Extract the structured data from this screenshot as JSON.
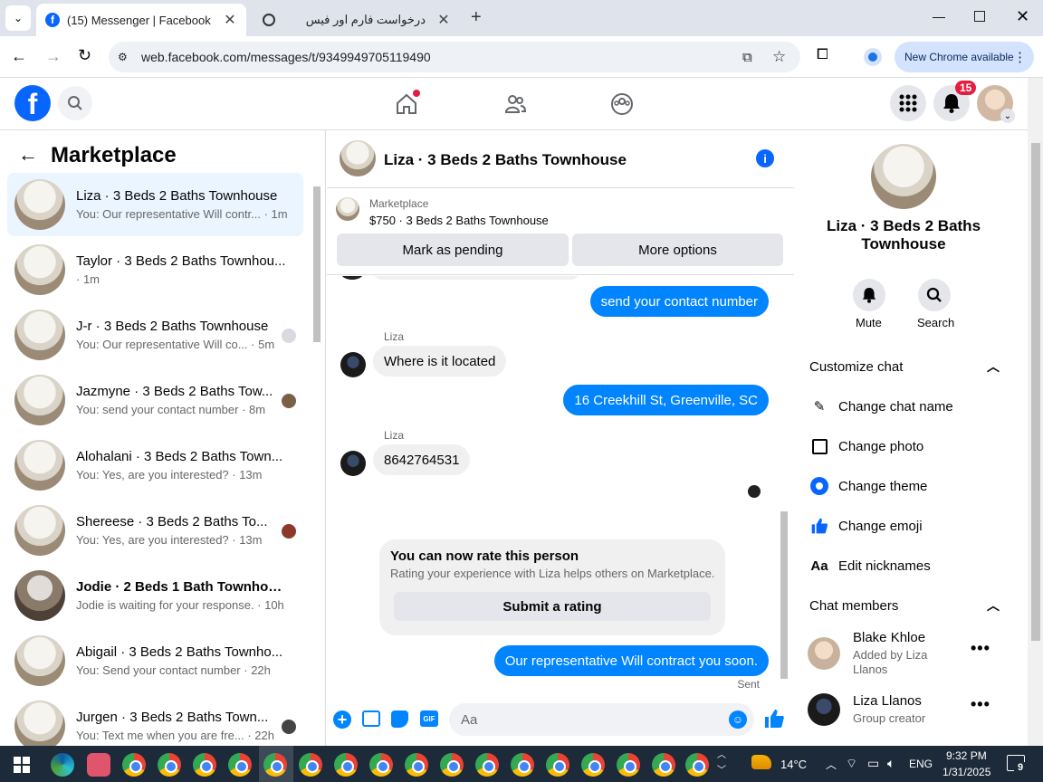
{
  "browser": {
    "tab1_title": "(15) Messenger | Facebook",
    "tab2_title": "درخواست فارم اور فیس",
    "url": "web.facebook.com/messages/t/9349949705119490",
    "new_chrome": "New Chrome available"
  },
  "header": {
    "notif_count": "15"
  },
  "left": {
    "title": "Marketplace",
    "conversations": [
      {
        "name": "Liza · 3 Beds 2 Baths Townhouse",
        "preview": "You: Our representative Will contr... · 1m"
      },
      {
        "name": "Taylor · 3 Beds 2 Baths Townhou...",
        "preview": "· 1m"
      },
      {
        "name": "J-r · 3 Beds 2 Baths Townhouse",
        "preview": "You: Our representative Will co... · 5m"
      },
      {
        "name": "Jazmyne · 3 Beds 2 Baths Tow...",
        "preview": "You: send your contact number · 8m"
      },
      {
        "name": "Alohalani · 3 Beds 2 Baths Town...",
        "preview": "You: Yes, are you interested? · 13m"
      },
      {
        "name": "Shereese · 3 Beds 2 Baths To...",
        "preview": "You: Yes, are you interested? · 13m"
      },
      {
        "name": "Jodie · 2 Beds 1 Bath Townhouse",
        "preview": "Jodie is waiting for your response. · 10h"
      },
      {
        "name": "Abigail · 3 Beds 2 Baths Townho...",
        "preview": "You: Send your contact number · 22h"
      },
      {
        "name": "Jurgen · 3 Beds 2 Baths Town...",
        "preview": "You: Text me when you are fre... · 22h"
      }
    ]
  },
  "chat": {
    "title": "Liza · 3 Beds 2 Baths Townhouse",
    "listing_source": "Marketplace",
    "listing_price": "$750 · 3 Beds 2 Baths Townhouse",
    "mark_pending": "Mark as pending",
    "more_options": "More options",
    "messages": [
      {
        "from": "me",
        "text": "send your contact number"
      },
      {
        "from": "Liza",
        "text": "Where is it located"
      },
      {
        "from": "me",
        "text": "16 Creekhill St, Greenville, SC"
      },
      {
        "from": "Liza",
        "text": "8642764531"
      }
    ],
    "rate_title": "You can now rate this person",
    "rate_sub": "Rating your experience with Liza helps others on Marketplace.",
    "rate_button": "Submit a rating",
    "last_message": "Our representative Will contract you soon.",
    "sent_status": "Sent",
    "input_placeholder": "Aa",
    "gif_label": "GIF"
  },
  "details": {
    "name": "Liza · 3 Beds 2 Baths Townhouse",
    "mute": "Mute",
    "search": "Search",
    "customize": "Customize chat",
    "change_name": "Change chat name",
    "change_photo": "Change photo",
    "change_theme": "Change theme",
    "change_emoji": "Change emoji",
    "edit_nicknames": "Edit nicknames",
    "aa": "Aa",
    "members_title": "Chat members",
    "members": [
      {
        "name": "Blake Khloe",
        "sub": "Added by Liza Llanos"
      },
      {
        "name": "Liza Llanos",
        "sub": "Group creator"
      }
    ]
  },
  "taskbar": {
    "temp": "14°C",
    "lang": "ENG",
    "time": "9:32 PM",
    "date": "1/31/2025",
    "notif": "9"
  },
  "colors": {
    "fb_blue": "#0866ff",
    "bubble_blue": "#0084ff",
    "badge_red": "#e41e3f"
  }
}
